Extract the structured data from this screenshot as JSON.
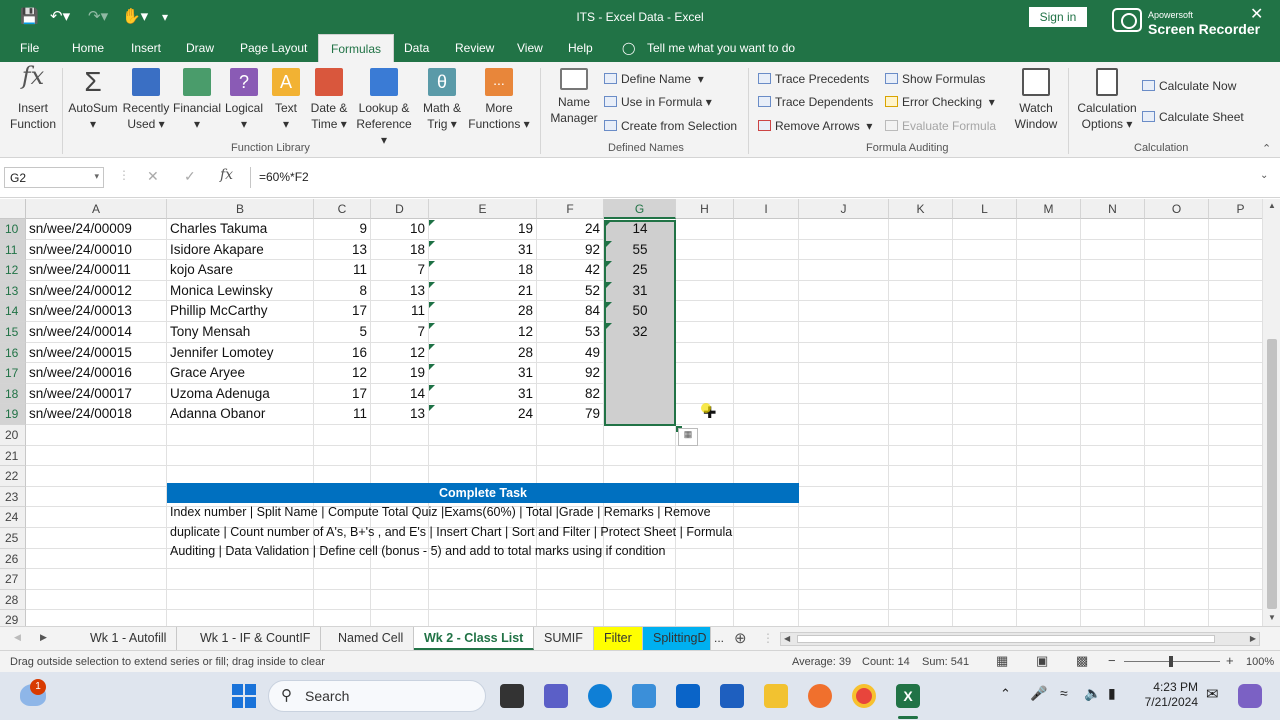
{
  "titlebar": {
    "title": "ITS - Excel Data - Excel",
    "sign_in": "Sign in",
    "recorder_small": "Apowersoft",
    "recorder_big": "Screen Recorder"
  },
  "menu": {
    "tabs": [
      "File",
      "Home",
      "Insert",
      "Draw",
      "Page Layout",
      "Formulas",
      "Data",
      "Review",
      "View",
      "Help"
    ],
    "tell_me": "Tell me what you want to do"
  },
  "ribbon": {
    "insert_function": [
      "Insert",
      "Function"
    ],
    "autosum": "AutoSum",
    "recently_used": [
      "Recently",
      "Used"
    ],
    "financial": "Financial",
    "logical": "Logical",
    "text": "Text",
    "date_time": [
      "Date &",
      "Time"
    ],
    "lookup_ref": [
      "Lookup &",
      "Reference"
    ],
    "math_trig": [
      "Math &",
      "Trig"
    ],
    "more_functions": [
      "More",
      "Functions"
    ],
    "group_function_library": "Function Library",
    "name_manager": [
      "Name",
      "Manager"
    ],
    "define_name": "Define Name",
    "use_in_formula": "Use in Formula",
    "create_from_selection": "Create from Selection",
    "group_defined_names": "Defined Names",
    "trace_precedents": "Trace Precedents",
    "trace_dependents": "Trace Dependents",
    "remove_arrows": "Remove Arrows",
    "show_formulas": "Show Formulas",
    "error_checking": "Error Checking",
    "evaluate_formula": "Evaluate Formula",
    "watch_window": [
      "Watch",
      "Window"
    ],
    "group_formula_auditing": "Formula Auditing",
    "calculation_options": [
      "Calculation",
      "Options"
    ],
    "calculate_now": "Calculate Now",
    "calculate_sheet": "Calculate Sheet",
    "group_calculation": "Calculation"
  },
  "formula_bar": {
    "name_box": "G2",
    "formula": "=60%*F2"
  },
  "columns": [
    "A",
    "B",
    "C",
    "D",
    "E",
    "F",
    "G",
    "H",
    "I",
    "J",
    "K",
    "L",
    "M",
    "N",
    "O",
    "P"
  ],
  "rows": [
    {
      "n": "10",
      "a": "sn/wee/24/00009",
      "b": "Charles Takuma",
      "c": "9",
      "d": "10",
      "e": "19",
      "f": "24",
      "g": "14"
    },
    {
      "n": "11",
      "a": "sn/wee/24/00010",
      "b": "Isidore Akapare",
      "c": "13",
      "d": "18",
      "e": "31",
      "f": "92",
      "g": "55"
    },
    {
      "n": "12",
      "a": "sn/wee/24/00011",
      "b": "kojo Asare",
      "c": "11",
      "d": "7",
      "e": "18",
      "f": "42",
      "g": "25"
    },
    {
      "n": "13",
      "a": "sn/wee/24/00012",
      "b": "Monica Lewinsky",
      "c": "8",
      "d": "13",
      "e": "21",
      "f": "52",
      "g": "31"
    },
    {
      "n": "14",
      "a": "sn/wee/24/00013",
      "b": "Phillip McCarthy",
      "c": "17",
      "d": "11",
      "e": "28",
      "f": "84",
      "g": "50"
    },
    {
      "n": "15",
      "a": "sn/wee/24/00014",
      "b": "Tony Mensah",
      "c": "5",
      "d": "7",
      "e": "12",
      "f": "53",
      "g": "32"
    },
    {
      "n": "16",
      "a": "sn/wee/24/00015",
      "b": "Jennifer Lomotey",
      "c": "16",
      "d": "12",
      "e": "28",
      "f": "49",
      "g": ""
    },
    {
      "n": "17",
      "a": "sn/wee/24/00016",
      "b": "Grace Aryee",
      "c": "12",
      "d": "19",
      "e": "31",
      "f": "92",
      "g": ""
    },
    {
      "n": "18",
      "a": "sn/wee/24/00017",
      "b": "Uzoma Adenuga",
      "c": "17",
      "d": "14",
      "e": "31",
      "f": "82",
      "g": ""
    },
    {
      "n": "19",
      "a": "sn/wee/24/00018",
      "b": "Adanna Obanor",
      "c": "11",
      "d": "13",
      "e": "24",
      "f": "79",
      "g": ""
    }
  ],
  "empty_rows": [
    "20",
    "21",
    "22",
    "23",
    "24",
    "25",
    "26",
    "27",
    "28",
    "29"
  ],
  "task": {
    "header": "Complete Task",
    "lines": [
      "Index number | Split Name | Compute Total Quiz |Exams(60%) | Total |Grade | Remarks | Remove",
      "duplicate | Count number of A's, B+'s  , and E's | Insert Chart | Sort and Filter | Protect Sheet | Formula",
      "Auditing | Data Validation | Define cell (bonus - 5) and add to total marks using if condition"
    ]
  },
  "sheet_tabs": [
    "Wk 1 - Autofill",
    "Wk 1 - IF & CountIF",
    "Named Cell",
    "Wk 2 - Class List",
    "SUMIF",
    "Filter",
    "SplittingD"
  ],
  "sheet_more": "...",
  "status": {
    "message": "Drag outside selection to extend series or fill; drag inside to clear",
    "average": "Average: 39",
    "count": "Count: 14",
    "sum": "Sum: 541",
    "zoom": "100%"
  },
  "taskbar": {
    "search": "Search",
    "time": "4:23 PM",
    "date": "7/21/2024",
    "notif_count": "1"
  },
  "colors": {
    "excel_green": "#217346",
    "task_blue": "#0070c0",
    "filter_tab": "#ffff00",
    "splitting_tab": "#00b0f0"
  }
}
